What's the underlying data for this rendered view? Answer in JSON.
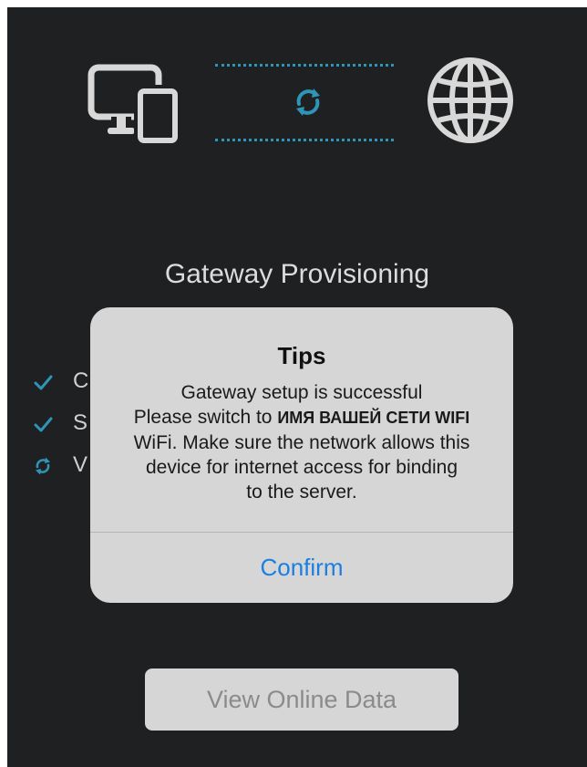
{
  "screen": {
    "title": "Gateway Provisioning",
    "colors": {
      "background": "#1f2022",
      "accent": "#2e95b8",
      "icon": "#d8d8d8"
    }
  },
  "top_graphic": {
    "left_icon": "devices-icon",
    "center_icon": "sync-icon",
    "right_icon": "globe-icon"
  },
  "steps": [
    {
      "status": "done",
      "icon": "check-icon",
      "label": "C"
    },
    {
      "status": "done",
      "icon": "check-icon",
      "label": "S"
    },
    {
      "status": "in-progress",
      "icon": "sync-icon",
      "label": "V"
    }
  ],
  "dialog": {
    "title": "Tips",
    "line1": "Gateway setup is successful",
    "line2_prefix": "Please switch to ",
    "ssid": "ИМЯ ВАШЕЙ СЕТИ WIFI",
    "line3": "WiFi. Make sure the network allows this",
    "line4": "device for internet access for binding",
    "line5": "to the server.",
    "confirm_label": "Confirm",
    "confirm_color": "#1a7fe0"
  },
  "view_button": {
    "label": "View Online Data"
  }
}
